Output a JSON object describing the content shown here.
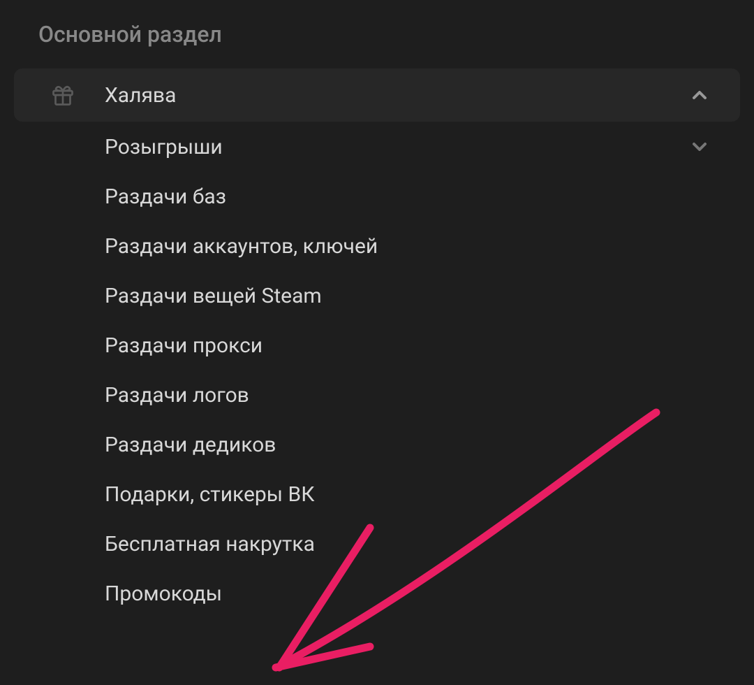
{
  "section": {
    "title": "Основной раздел"
  },
  "menu": {
    "main": {
      "label": "Халява",
      "icon": "gift-icon"
    },
    "items": [
      {
        "label": "Розыгрыши",
        "hasChevron": true
      },
      {
        "label": "Раздачи баз",
        "hasChevron": false
      },
      {
        "label": "Раздачи аккаунтов, ключей",
        "hasChevron": false
      },
      {
        "label": "Раздачи вещей Steam",
        "hasChevron": false
      },
      {
        "label": "Раздачи прокси",
        "hasChevron": false
      },
      {
        "label": "Раздачи логов",
        "hasChevron": false
      },
      {
        "label": "Раздачи дедиков",
        "hasChevron": false
      },
      {
        "label": "Подарки, стикеры ВК",
        "hasChevron": false
      },
      {
        "label": "Бесплатная накрутка",
        "hasChevron": false
      },
      {
        "label": "Промокоды",
        "hasChevron": false
      }
    ]
  },
  "annotation": {
    "color": "#e91e63"
  }
}
